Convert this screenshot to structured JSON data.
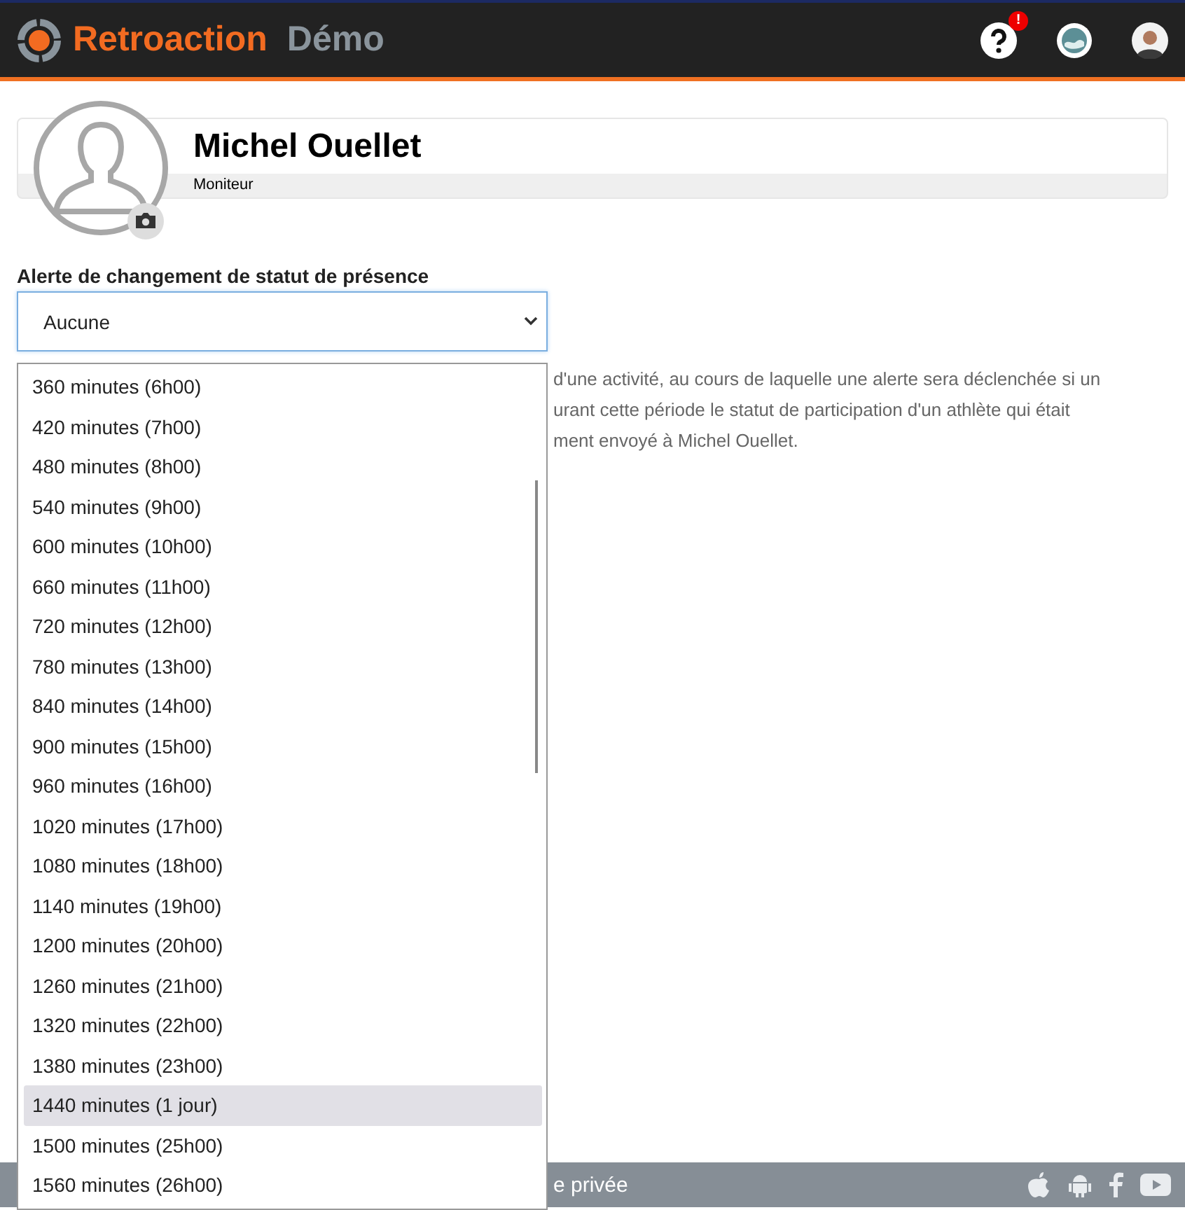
{
  "header": {
    "brand": "Retroaction",
    "edition": "Démo",
    "help_badge": "!"
  },
  "profile": {
    "name": "Michel Ouellet",
    "role": "Moniteur"
  },
  "alert_field": {
    "label": "Alerte de changement de statut de présence",
    "value": "Aucune"
  },
  "description_lines": [
    "d'une activité, au cours de laquelle une alerte sera déclenchée si un",
    "urant cette période le statut de participation d'un athlète qui était",
    "ment envoyé à Michel Ouellet."
  ],
  "options": [
    {
      "label": "360 minutes (6h00)",
      "selected": false
    },
    {
      "label": "420 minutes (7h00)",
      "selected": false
    },
    {
      "label": "480 minutes (8h00)",
      "selected": false
    },
    {
      "label": "540 minutes (9h00)",
      "selected": false
    },
    {
      "label": "600 minutes (10h00)",
      "selected": false
    },
    {
      "label": "660 minutes (11h00)",
      "selected": false
    },
    {
      "label": "720 minutes (12h00)",
      "selected": false
    },
    {
      "label": "780 minutes (13h00)",
      "selected": false
    },
    {
      "label": "840 minutes (14h00)",
      "selected": false
    },
    {
      "label": "900 minutes (15h00)",
      "selected": false
    },
    {
      "label": "960 minutes (16h00)",
      "selected": false
    },
    {
      "label": "1020 minutes (17h00)",
      "selected": false
    },
    {
      "label": "1080 minutes (18h00)",
      "selected": false
    },
    {
      "label": "1140 minutes (19h00)",
      "selected": false
    },
    {
      "label": "1200 minutes (20h00)",
      "selected": false
    },
    {
      "label": "1260 minutes (21h00)",
      "selected": false
    },
    {
      "label": "1320 minutes (22h00)",
      "selected": false
    },
    {
      "label": "1380 minutes (23h00)",
      "selected": false
    },
    {
      "label": "1440 minutes (1 jour)",
      "selected": true
    },
    {
      "label": "1500 minutes (25h00)",
      "selected": false
    },
    {
      "label": "1560 minutes (26h00)",
      "selected": false
    }
  ],
  "footer": {
    "middle": "e privée"
  }
}
